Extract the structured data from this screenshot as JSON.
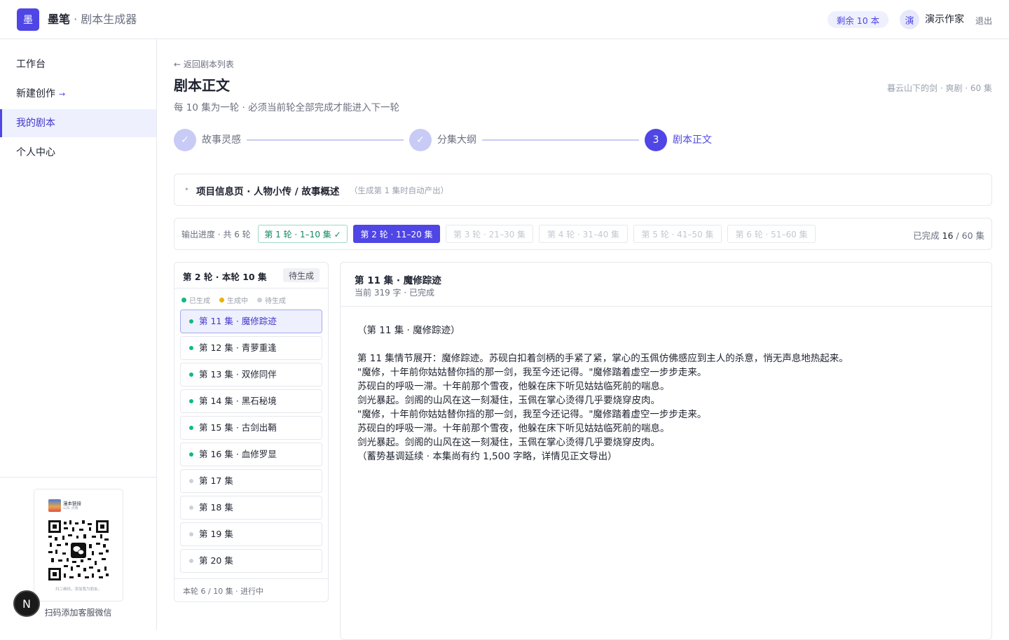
{
  "header": {
    "logo_char": "墨",
    "brand_name": "墨笔",
    "brand_sep": " · ",
    "brand_product": "剧本生成器",
    "quota": "剩余 10 本",
    "avatar_char": "演",
    "username": "演示作家",
    "logout": "退出"
  },
  "sidebar": {
    "items": [
      {
        "label": "工作台"
      },
      {
        "label": "新建创作",
        "suffix_icon": "→"
      },
      {
        "label": "我的剧本"
      },
      {
        "label": "个人中心"
      }
    ],
    "qr_card_title": "漫本链接",
    "qr_card_sub": "山东 济南",
    "qr_card_hint": "扫二维码，添加我为朋友。",
    "qr_caption": "扫码添加客服微信",
    "n_badge": "N"
  },
  "page": {
    "back_link": "← 返回剧本列表",
    "title": "剧本正文",
    "subtitle": "每 10 集为一轮 · 必须当前轮全部完成才能进入下一轮",
    "meta": "暮云山下的剑 · 爽剧 · 60 集"
  },
  "steps": [
    {
      "label": "故事灵感",
      "mark": "✓",
      "status": "done"
    },
    {
      "label": "分集大纲",
      "mark": "✓",
      "status": "done"
    },
    {
      "label": "剧本正文",
      "mark": "3",
      "status": "current"
    }
  ],
  "project_info": {
    "caret": "▸",
    "title": "项目信息页 · 人物小传 / 故事概述",
    "note": "（生成第 1 集时自动产出）"
  },
  "progress": {
    "label": "输出进度 · 共 6 轮",
    "rounds": [
      {
        "label": "第 1 轮 · 1–10 集 ✓",
        "status": "done"
      },
      {
        "label": "第 2 轮 · 11–20 集",
        "status": "current"
      },
      {
        "label": "第 3 轮 · 21–30 集",
        "status": "locked"
      },
      {
        "label": "第 4 轮 · 31–40 集",
        "status": "locked"
      },
      {
        "label": "第 5 轮 · 41–50 集",
        "status": "locked"
      },
      {
        "label": "第 6 轮 · 51–60 集",
        "status": "locked"
      }
    ],
    "done_prefix": "已完成 ",
    "done_count": "16",
    "done_suffix": " / 60 集"
  },
  "episodes_panel": {
    "heading": "第 2 轮 · 本轮 10 集",
    "badge": "待生成",
    "legend": [
      {
        "label": "已生成",
        "color": "#10b981"
      },
      {
        "label": "生成中",
        "color": "#eab308"
      },
      {
        "label": "待生成",
        "color": "#cbd0d9"
      }
    ],
    "episodes": [
      {
        "label": "第 11 集 · 魔修踪迹",
        "status": "generated",
        "selected": true
      },
      {
        "label": "第 12 集 · 青萝重逢",
        "status": "generated"
      },
      {
        "label": "第 13 集 · 双修同伴",
        "status": "generated"
      },
      {
        "label": "第 14 集 · 黑石秘境",
        "status": "generated"
      },
      {
        "label": "第 15 集 · 古剑出鞘",
        "status": "generated"
      },
      {
        "label": "第 16 集 · 血修罗显",
        "status": "generated"
      },
      {
        "label": "第 17 集",
        "status": "pending"
      },
      {
        "label": "第 18 集",
        "status": "pending"
      },
      {
        "label": "第 19 集",
        "status": "pending"
      },
      {
        "label": "第 20 集",
        "status": "pending"
      }
    ],
    "footer": "本轮 6 / 10 集 · 进行中"
  },
  "document": {
    "title": "第 11 集 · 魔修踪迹",
    "subtitle": "当前 319 字 · 已完成",
    "lines": [
      "（第 11 集 · 魔修踪迹）",
      "",
      "第 11 集情节展开：魔修踪迹。苏砚白扣着剑柄的手紧了紧，掌心的玉佩仿佛感应到主人的杀意，悄无声息地热起来。",
      "\"魔修，十年前你姑姑替你挡的那一剑，我至今还记得。\"魔修踏着虚空一步步走来。",
      "苏砚白的呼吸一滞。十年前那个雪夜，他躲在床下听见姑姑临死前的喘息。",
      "剑光暴起。剑阁的山风在这一刻凝住，玉佩在掌心烫得几乎要烧穿皮肉。",
      "\"魔修，十年前你姑姑替你挡的那一剑，我至今还记得。\"魔修踏着虚空一步步走来。",
      "苏砚白的呼吸一滞。十年前那个雪夜，他躲在床下听见姑姑临死前的喘息。",
      "剑光暴起。剑阁的山风在这一刻凝住，玉佩在掌心烫得几乎要烧穿皮肉。",
      "（蓄势基调延续 · 本集尚有约 1,500 字略，详情见正文导出）"
    ]
  },
  "colors": {
    "accent": "#4f46e5",
    "accent_light": "#eef0fe",
    "generated": "#10b981",
    "generating": "#eab308",
    "pending": "#cbd0d9"
  }
}
